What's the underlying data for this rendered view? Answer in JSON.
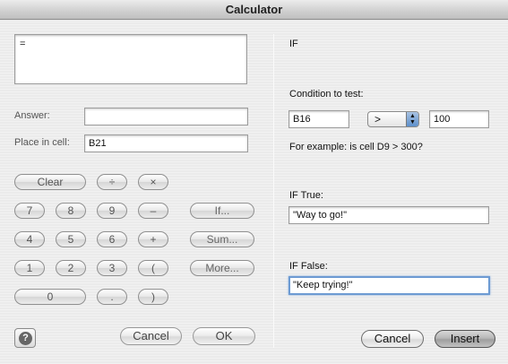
{
  "window": {
    "title": "Calculator"
  },
  "left": {
    "formula_text": "=",
    "answer": {
      "label": "Answer:",
      "value": ""
    },
    "place_in_cell": {
      "label": "Place in cell:",
      "value": "B21"
    },
    "keys": {
      "clear": "Clear",
      "divide": "÷",
      "multiply": "×",
      "k7": "7",
      "k8": "8",
      "k9": "9",
      "minus": "–",
      "k4": "4",
      "k5": "5",
      "k6": "6",
      "plus": "+",
      "k1": "1",
      "k2": "2",
      "k3": "3",
      "open_paren": "(",
      "k0": "0",
      "dot": ".",
      "close_paren": ")",
      "if": "If...",
      "sum": "Sum...",
      "more": "More..."
    },
    "help_glyph": "?",
    "cancel": "Cancel",
    "ok": "OK"
  },
  "right": {
    "heading": "IF",
    "condition_label": "Condition to test:",
    "condition_left": "B16",
    "operator": ">",
    "condition_right": "100",
    "example": "For example: is cell D9 > 300?",
    "if_true_label": "IF True:",
    "if_true_value": "\"Way to go!\"",
    "if_false_label": "IF False:",
    "if_false_value": "\"Keep trying!\"",
    "cancel": "Cancel",
    "insert": "Insert"
  },
  "colors": {
    "focus_ring": "#6d9bd3",
    "window_bg": "#ebebeb"
  }
}
